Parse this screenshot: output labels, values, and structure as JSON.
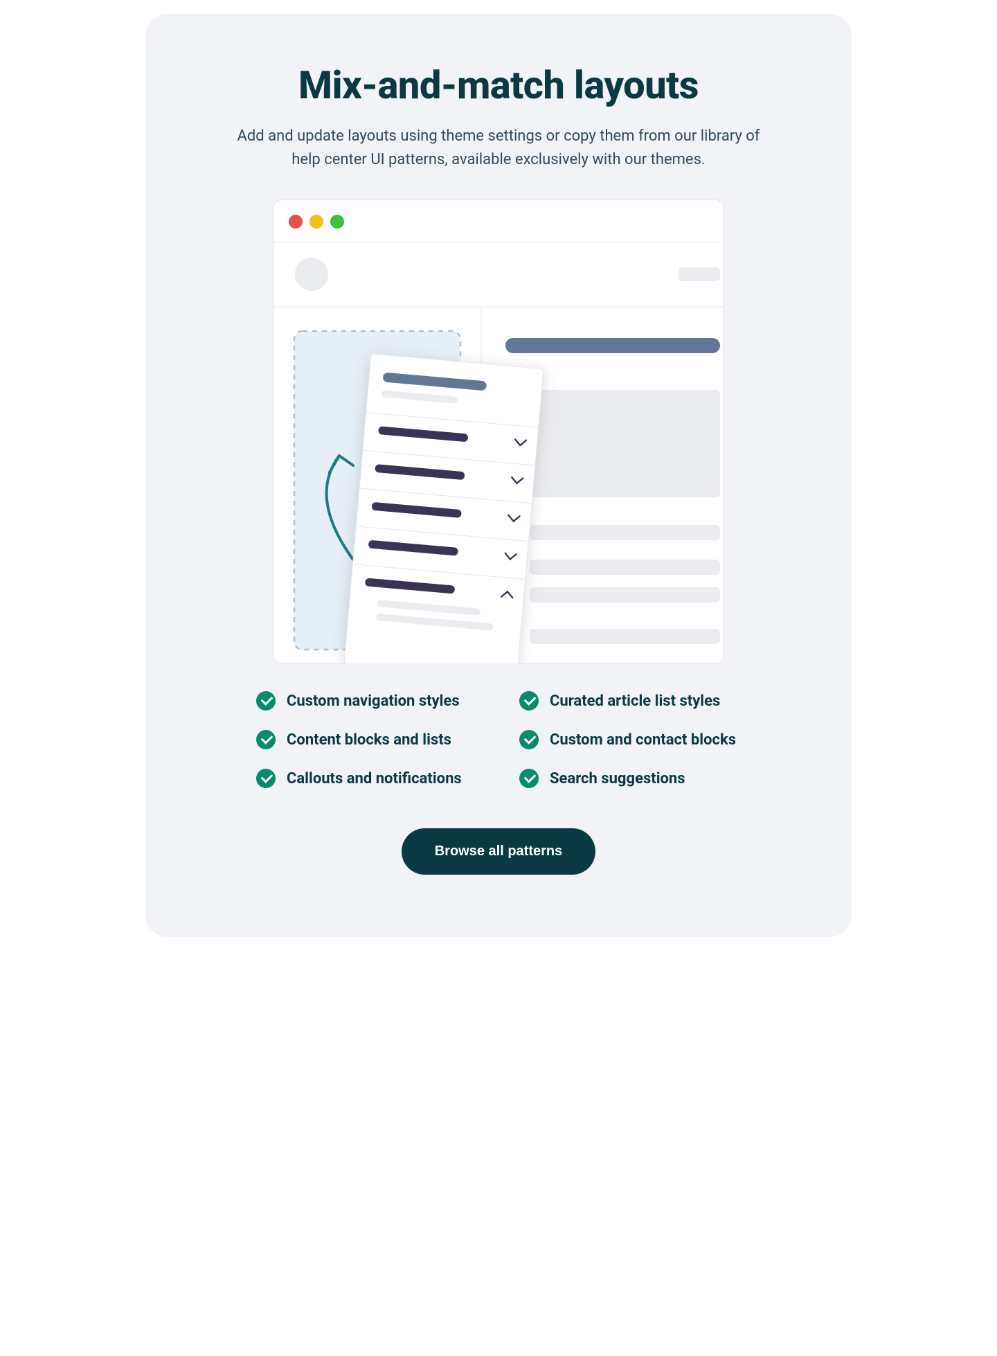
{
  "title": "Mix-and-match layouts",
  "subtitle": "Add and update layouts using theme settings or copy them from our library of help center UI patterns, available exclusively with our themes.",
  "features": {
    "row0": {
      "left": "Custom navigation styles",
      "right": "Curated article list styles"
    },
    "row1": {
      "left": "Content blocks and lists",
      "right": "Custom and contact blocks"
    },
    "row2": {
      "left": "Callouts and notifications",
      "right": "Search suggestions"
    }
  },
  "cta_label": "Browse all patterns",
  "colors": {
    "accent": "#088A6C",
    "text_dark": "#0B3943",
    "card_bg": "#F1F3F6"
  }
}
